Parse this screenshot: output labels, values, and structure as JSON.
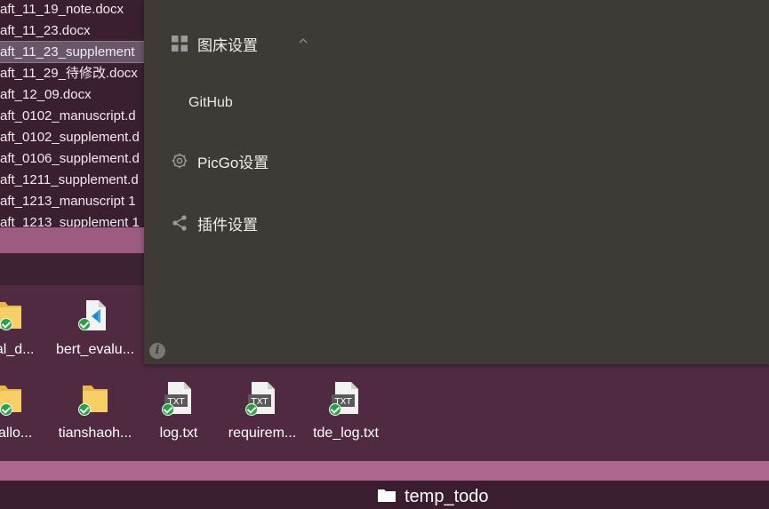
{
  "file_list": {
    "items": [
      "aft_11_19_note.docx",
      "aft_11_23.docx",
      "aft_11_23_supplement",
      "aft_11_29_待修改.docx",
      "aft_12_09.docx",
      "aft_0102_manuscript.d",
      "aft_0102_supplement.d",
      "aft_0106_supplement.d",
      "aft_1211_supplement.d",
      "aft_1213_manuscript 1",
      "aft_1213_supplement 1"
    ],
    "selected_index": 2
  },
  "settings_panel": {
    "section_image_bed": {
      "label": "图床设置",
      "icon": "grid-icon",
      "expanded": true
    },
    "sub_github": {
      "label": "GitHub"
    },
    "section_picgo": {
      "label": "PicGo设置",
      "icon": "gear-icon"
    },
    "section_plugins": {
      "label": "插件设置",
      "icon": "share-icon"
    },
    "info_icon": "info-icon"
  },
  "desktop_icons": [
    {
      "label": "tual_d...",
      "type": "folder"
    },
    {
      "label": "bert_evalu...",
      "type": "vscode-file"
    },
    {
      "label": "erallo...",
      "type": "folder"
    },
    {
      "label": "tianshaoh...",
      "type": "folder"
    },
    {
      "label": "log.txt",
      "type": "txt",
      "badge": "TXT"
    },
    {
      "label": "requirem...",
      "type": "txt",
      "badge": "TXT"
    },
    {
      "label": "tde_log.txt",
      "type": "txt",
      "badge": "TXT"
    }
  ],
  "taskbar": {
    "label": "temp_todo",
    "icon": "folder-icon"
  },
  "colors": {
    "panel_bg": "#3e3b36",
    "desktop_bg": "#4f2a41",
    "sync_check": "#25a244"
  }
}
